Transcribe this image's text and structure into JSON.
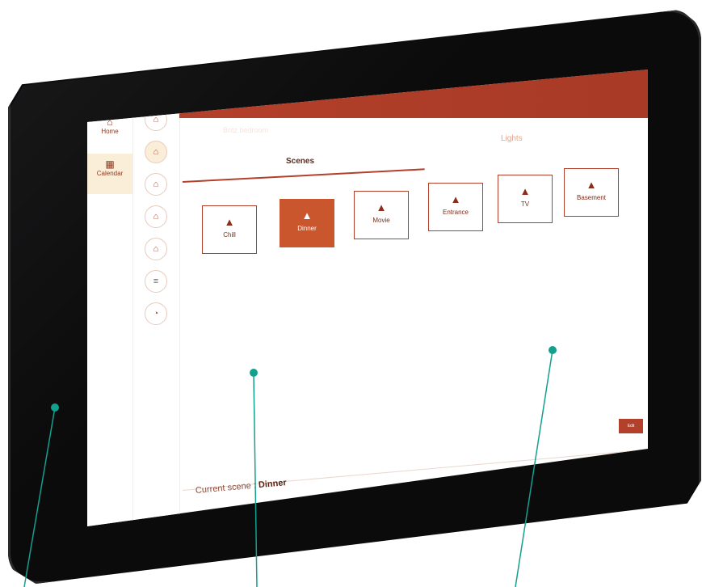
{
  "nav": {
    "items": [
      {
        "id": "home",
        "label": "Home",
        "icon": "home-icon"
      },
      {
        "id": "calendar",
        "label": "Calendar",
        "icon": "calendar-icon"
      }
    ]
  },
  "rooms": {
    "count": 7,
    "active_index": 1
  },
  "header": {
    "title": "Britz bedroom",
    "icon": "bed-icon"
  },
  "tabs": {
    "scenes": "Scenes",
    "lights": "Lights"
  },
  "scenes": [
    {
      "label": "Chill",
      "active": false
    },
    {
      "label": "Dinner",
      "active": true
    },
    {
      "label": "Movie",
      "active": false
    },
    {
      "label": "Entrance",
      "active": false
    },
    {
      "label": "TV",
      "active": false
    },
    {
      "label": "Basement",
      "active": false
    }
  ],
  "footer": {
    "current_label": "Current scene :",
    "current_value": "Dinner",
    "button": "Edit"
  },
  "colors": {
    "accent": "#b3402a",
    "active_tile": "#c9562c",
    "callout": "#13a08e",
    "highlight": "#fbeed9"
  }
}
